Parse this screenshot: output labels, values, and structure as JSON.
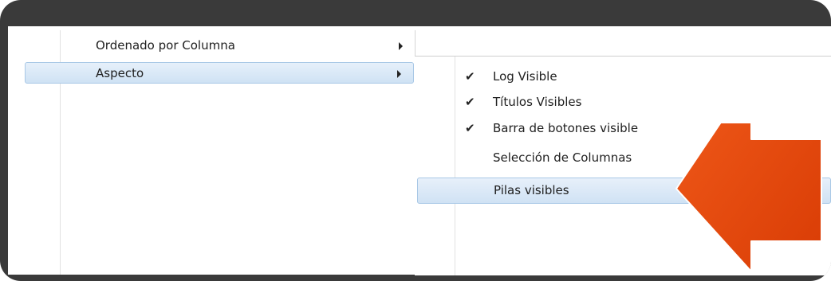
{
  "menu": {
    "items": [
      {
        "label": "Ordenado por Columna",
        "has_submenu": true
      },
      {
        "label": "Aspecto",
        "has_submenu": true,
        "highlighted": true
      }
    ]
  },
  "submenu": {
    "items": [
      {
        "label": "Log Visible",
        "checked": true
      },
      {
        "label": "Títulos Visibles",
        "checked": true
      },
      {
        "label": "Barra de botones visible",
        "checked": true
      },
      {
        "label": "Selección de Columnas",
        "checked": false
      },
      {
        "label": "Pilas visibles",
        "checked": false,
        "highlighted": true
      }
    ],
    "check_glyph": "✔"
  },
  "annotation": {
    "arrow_color": "#e8470f",
    "arrow_icon": "big-orange-arrow-icon"
  }
}
